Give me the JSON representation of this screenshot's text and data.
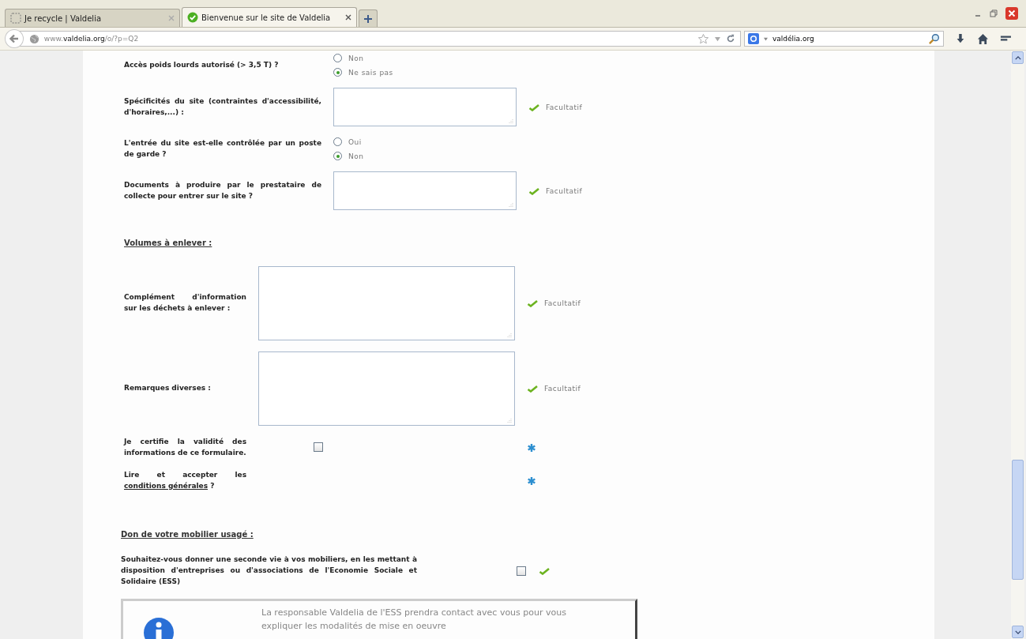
{
  "browser": {
    "tabs": [
      {
        "title": "Je recycle | Valdelia",
        "selected": false
      },
      {
        "title": "Bienvenue sur le site de Valdelia",
        "selected": true
      }
    ],
    "url": {
      "prefix": "www.",
      "domain": "valdelia.org",
      "path": "/o/?p=Q2"
    },
    "search": {
      "value": "valdélia.org"
    }
  },
  "sections": [
    {
      "rows": [
        {
          "kind": "radio",
          "label": "Accès poids lourds autorisé (> 3,5 T) ?",
          "options": [
            {
              "label": "Non",
              "selected": false
            },
            {
              "label": "Ne sais pas",
              "selected": true
            }
          ]
        },
        {
          "kind": "textarea",
          "label": "Spécificités du site (contraintes d'accessibilité, d'horaires,...) :",
          "note": "Facultatif"
        },
        {
          "kind": "radio",
          "label": "L'entrée du site est-elle contrôlée par un poste de garde ?",
          "options": [
            {
              "label": "Oui",
              "selected": false
            },
            {
              "label": "Non",
              "selected": true
            }
          ]
        },
        {
          "kind": "textarea",
          "label": "Documents à produire par le prestataire de collecte pour entrer sur le site ?",
          "note": "Facultatif"
        }
      ]
    },
    {
      "heading": "Volumes à enlever :",
      "rows": [
        {
          "kind": "textarea",
          "label": "Complément d'information sur les déchets à enlever :",
          "note": "Facultatif"
        },
        {
          "kind": "textarea",
          "label": "Remarques diverses :",
          "note": "Facultatif"
        },
        {
          "kind": "checkbox",
          "label": "Je certifie la validité des informations de ce formulaire.",
          "checked": false,
          "required": true
        },
        {
          "kind": "link",
          "label": "Lire et accepter les",
          "link": "conditions générales",
          "label_end": "?",
          "required": true
        }
      ]
    },
    {
      "heading": "Don de votre mobilier usagé :",
      "rows": [
        {
          "kind": "checkbox",
          "label": "Souhaitez-vous donner une seconde vie à vos mobiliers, en les mettant à disposition d'entreprises ou d'associations de l'Economie Sociale et Solidaire (ESS)",
          "checked": false,
          "required": false
        }
      ]
    }
  ],
  "info": {
    "text": "La responsable Valdelia de l'ESS prendra contact avec vous pour vous expliquer les modalités de mise en oeuvre"
  }
}
